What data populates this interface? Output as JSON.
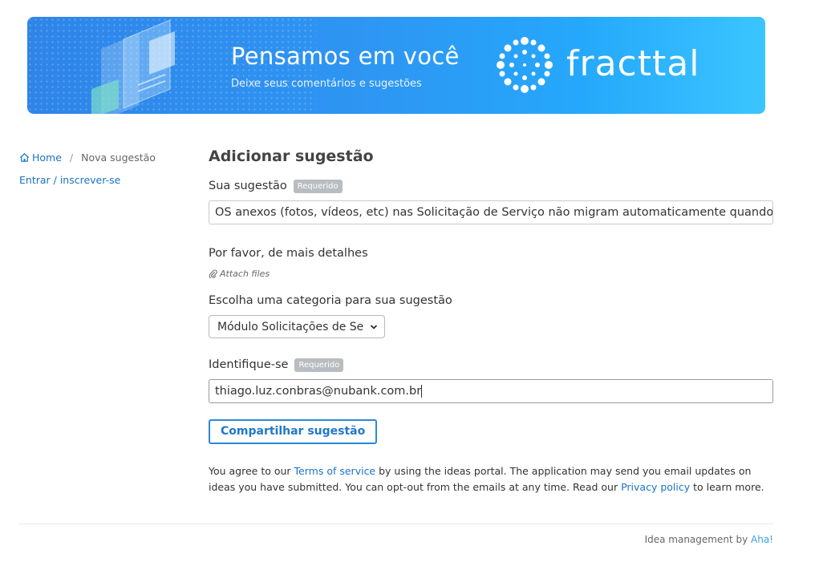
{
  "banner": {
    "title": "Pensamos em você",
    "subtitle": "Deixe seus comentários e sugestões",
    "brand": "fracttal"
  },
  "breadcrumb": {
    "home": "Home",
    "separator": "/",
    "current": "Nova sugestão"
  },
  "sidebar": {
    "login_link": "Entrar / inscrever-se"
  },
  "form": {
    "title": "Adicionar sugestão",
    "required_badge": "Requerido",
    "suggestion_label": "Sua sugestão",
    "suggestion_value": "OS anexos (fotos, vídeos, etc) nas Solicitação de Serviço não migram automaticamente quando",
    "details_label": "Por favor, de mais detalhes",
    "attach_label": "Attach files",
    "category_label": "Escolha uma categoria para sua sugestão",
    "category_value": "Módulo Solicitações de Se",
    "identify_label": "Identifique-se",
    "email_value": "thiago.luz.conbras@nubank.com.br",
    "submit_label": "Compartilhar sugestão"
  },
  "terms": {
    "part1": "You agree to our ",
    "tos_link": "Terms of service",
    "part2": " by using the ideas portal. The application may send you email updates on ideas you have submitted. You can opt-out from the emails at any time. Read our ",
    "privacy_link": "Privacy policy",
    "part3": " to learn more."
  },
  "footer": {
    "text": "Idea management by ",
    "link": "Aha!"
  },
  "colors": {
    "link": "#1a73c8",
    "button_border": "#2c88d9",
    "badge": "#b9bcc0",
    "banner_start": "#2f84e8",
    "banner_end": "#3ac5ff"
  },
  "icons": {
    "home": "home-icon",
    "attach": "paperclip-icon",
    "select": "chevron-down-icon"
  }
}
